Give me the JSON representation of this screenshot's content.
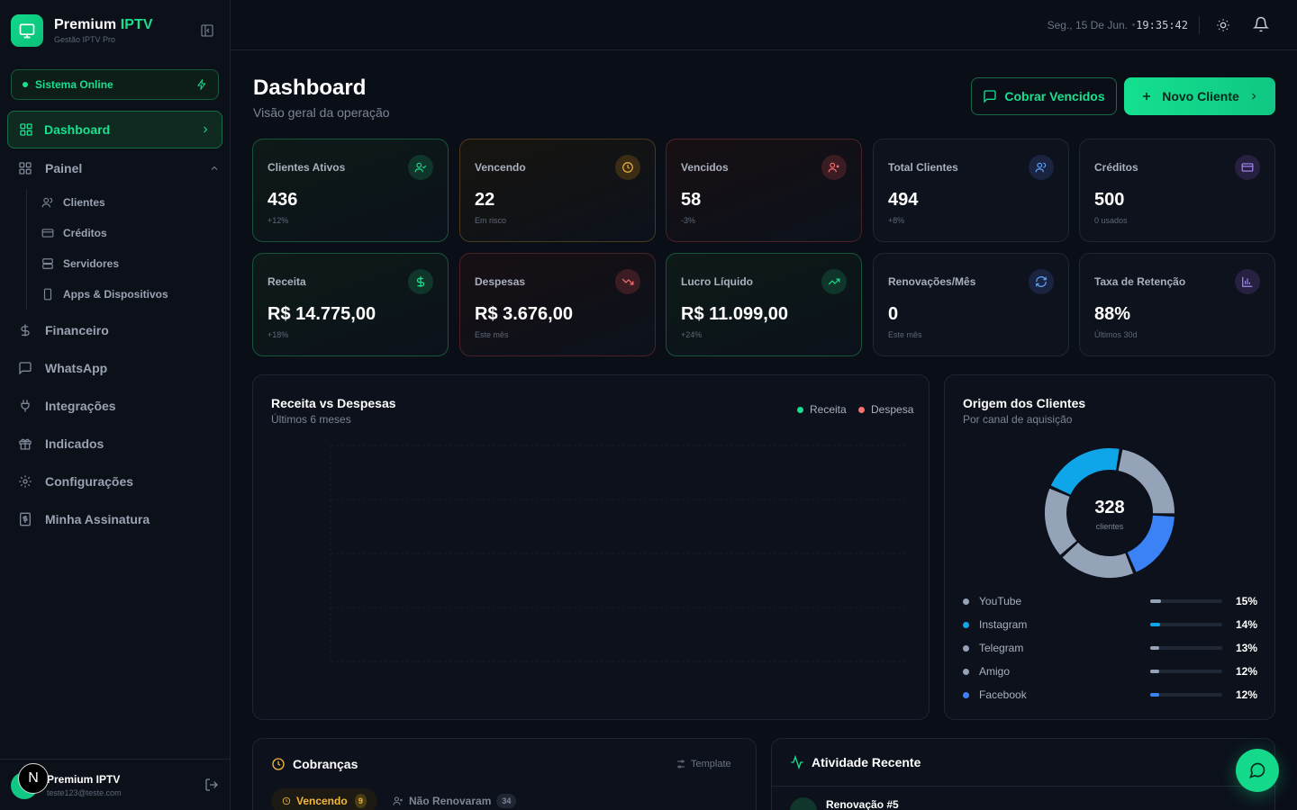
{
  "brand": {
    "name_main": "Premium",
    "name_accent": "IPTV",
    "subtitle": "Gestão IPTV Pro"
  },
  "status": {
    "label": "Sistema Online"
  },
  "nav": {
    "dashboard": "Dashboard",
    "painel": "Painel",
    "painel_sub": [
      "Clientes",
      "Créditos",
      "Servidores",
      "Apps & Dispositivos"
    ],
    "financeiro": "Financeiro",
    "whatsapp": "WhatsApp",
    "integracoes": "Integrações",
    "indicados": "Indicados",
    "configuracoes": "Configurações",
    "assinatura": "Minha Assinatura"
  },
  "user": {
    "initial": "N",
    "name": "Premium IPTV",
    "email": "teste123@teste.com"
  },
  "header": {
    "date": "Seg., 15 De Jun.",
    "time": "19:35:42"
  },
  "page": {
    "title": "Dashboard",
    "subtitle": "Visão geral da operação"
  },
  "actions": {
    "charge_overdue": "Cobrar Vencidos",
    "new_client": "Novo Cliente"
  },
  "stats": [
    {
      "label": "Clientes Ativos",
      "value": "436",
      "note": "+12%"
    },
    {
      "label": "Vencendo",
      "value": "22",
      "note": "Em risco"
    },
    {
      "label": "Vencidos",
      "value": "58",
      "note": "-3%"
    },
    {
      "label": "Total Clientes",
      "value": "494",
      "note": "+8%"
    },
    {
      "label": "Créditos",
      "value": "500",
      "note": "0 usados"
    },
    {
      "label": "Receita",
      "value": "R$ 14.775,00",
      "note": "+18%"
    },
    {
      "label": "Despesas",
      "value": "R$ 3.676,00",
      "note": "Este mês"
    },
    {
      "label": "Lucro Líquido",
      "value": "R$ 11.099,00",
      "note": "+24%"
    },
    {
      "label": "Renovações/Mês",
      "value": "0",
      "note": "Este mês"
    },
    {
      "label": "Taxa de Retenção",
      "value": "88%",
      "note": "Últimos 30d"
    }
  ],
  "revenue_chart": {
    "title": "Receita vs Despesas",
    "subtitle": "Últimos 6 meses",
    "legend_revenue": "Receita",
    "legend_expense": "Despesa"
  },
  "origin": {
    "title": "Origem dos Clientes",
    "subtitle": "Por canal de aquisição",
    "total": "328",
    "total_label": "clientes",
    "sources": [
      {
        "name": "YouTube",
        "pct": "15%",
        "value": 15,
        "color": "#94a3b8"
      },
      {
        "name": "Instagram",
        "pct": "14%",
        "value": 14,
        "color": "#0ea5e9"
      },
      {
        "name": "Telegram",
        "pct": "13%",
        "value": 13,
        "color": "#94a3b8"
      },
      {
        "name": "Amigo",
        "pct": "12%",
        "value": 12,
        "color": "#94a3b8"
      },
      {
        "name": "Facebook",
        "pct": "12%",
        "value": 12,
        "color": "#3b82f6"
      }
    ]
  },
  "cobrancas": {
    "title": "Cobranças",
    "template": "Template",
    "tab_due": "Vencendo",
    "tab_due_count": "9",
    "tab_not_renewed": "Não Renovaram",
    "tab_not_renewed_count": "34"
  },
  "activity": {
    "title": "Atividade Recente",
    "first_item": "Renovação #5"
  },
  "colors": {
    "accent": "#18e08e",
    "warning": "#f4b63c",
    "danger": "#f87171",
    "blue": "#3b82f6",
    "purple": "#a78bfa"
  }
}
